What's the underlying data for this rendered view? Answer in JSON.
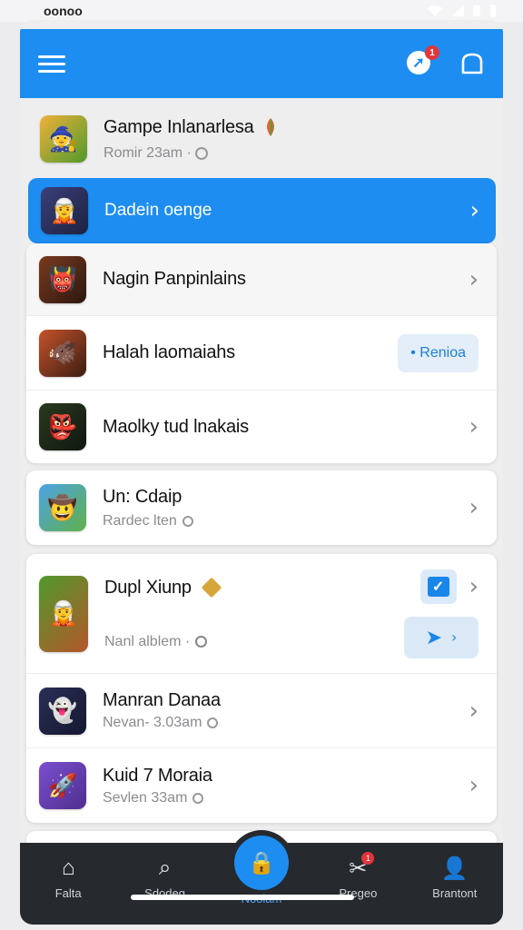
{
  "status": {
    "time": "oonoo"
  },
  "appbar": {
    "notif_badge": "1"
  },
  "header_item": {
    "title": "Gampe Inlanarlesa",
    "subtitle": "Romir 23am ·",
    "icon": "game-hero-icon"
  },
  "selected_item": {
    "title": "Dadein oenge",
    "icon": "game-wizard-icon"
  },
  "group1": [
    {
      "title": "Nagin Panpinlains",
      "icon": "game-monster-icon"
    },
    {
      "title": "Halah laomaiahs",
      "icon": "game-orc-icon",
      "pill": "• Renioa"
    },
    {
      "title": "Maolky tud lnakais",
      "icon": "game-goblin-icon"
    }
  ],
  "group2": [
    {
      "title": "Un: Cdaip",
      "subtitle": "Rardec lten",
      "icon": "game-adventure-icon"
    }
  ],
  "group3": [
    {
      "title": "Dupl Xiunp",
      "subtitle": "Nanl alblem ·",
      "icon": "game-warrior-icon"
    },
    {
      "title": "Manran Danaa",
      "subtitle": "Nevan- 3.03am",
      "icon": "game-puzzle-icon"
    },
    {
      "title": "Kuid 7 Moraia",
      "subtitle": "Sevlen 33am",
      "icon": "game-rocket-icon"
    }
  ],
  "bottom_nav": [
    {
      "label": "Falta",
      "icon": "home-icon"
    },
    {
      "label": "Sdodeg",
      "icon": "search-icon"
    },
    {
      "label": "Noolam",
      "icon": "bag-icon"
    },
    {
      "label": "Pregeo",
      "icon": "tools-icon",
      "badge": "1"
    },
    {
      "label": "Brantont",
      "icon": "profile-icon"
    }
  ]
}
